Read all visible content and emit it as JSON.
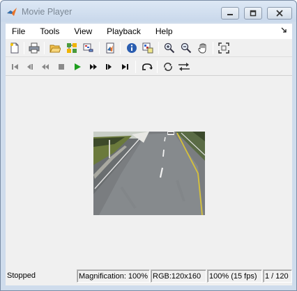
{
  "window": {
    "title": "Movie Player"
  },
  "menu": [
    {
      "label": "File"
    },
    {
      "label": "Tools"
    },
    {
      "label": "View"
    },
    {
      "label": "Playback"
    },
    {
      "label": "Help"
    }
  ],
  "menu_overflow_icon": "dock-arrow-icon",
  "toolbar1": [
    "new-figure-icon",
    "print-icon",
    "open-file-icon",
    "connect-simulink-icon",
    "export-icon",
    "open-matlab-icon",
    "info-icon",
    "pixel-region-icon",
    "zoom-in-icon",
    "zoom-out-icon",
    "pan-icon",
    "fit-to-window-icon"
  ],
  "toolbar2": [
    "go-to-first-icon",
    "step-back-icon",
    "rewind-icon",
    "stop-icon",
    "play-icon",
    "fast-forward-icon",
    "step-forward-icon",
    "go-to-last-icon",
    "jump-to-icon",
    "playback-loop-icon",
    "forward-backward-icon"
  ],
  "status": {
    "state": "Stopped",
    "magnification": "Magnification: 100%",
    "format": "RGB:120x160",
    "rate": "100% (15 fps)",
    "frame": "1 / 120"
  },
  "colors": {
    "play_green": "#1e9e1e",
    "titlebar": "#cfdcec",
    "client": "#f0f0f0"
  }
}
